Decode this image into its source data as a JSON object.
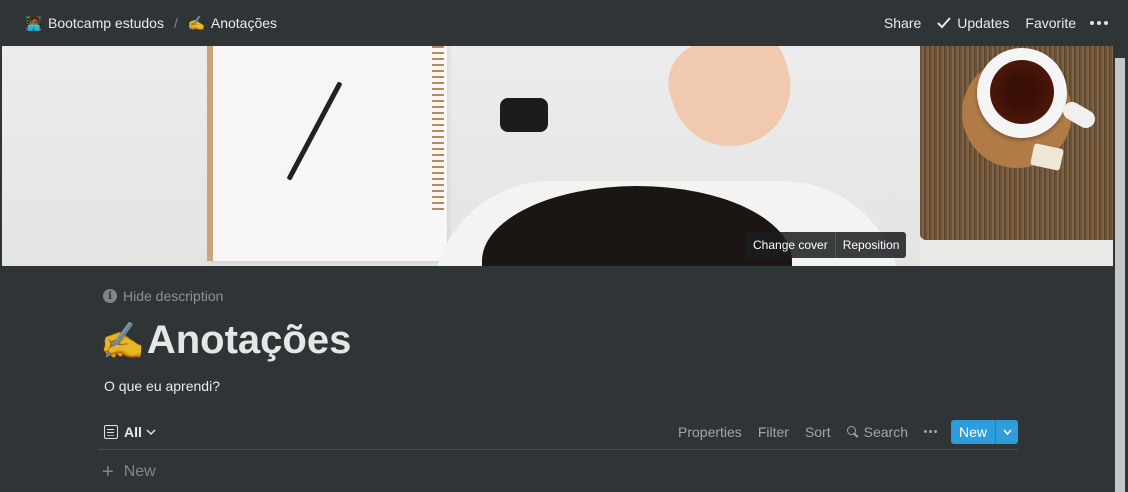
{
  "breadcrumb": {
    "items": [
      {
        "emoji": "👩🏾‍💻",
        "label": "Bootcamp estudos"
      },
      {
        "emoji": "✍️",
        "label": "Anotações"
      }
    ],
    "separator": "/"
  },
  "topbar": {
    "share_label": "Share",
    "updates_label": "Updates",
    "favorite_label": "Favorite"
  },
  "cover": {
    "change_cover_label": "Change cover",
    "reposition_label": "Reposition"
  },
  "page": {
    "hide_description_label": "Hide description",
    "title_emoji": "✍️",
    "title": "Anotações",
    "description": "O que eu aprendi?"
  },
  "view": {
    "name": "All",
    "properties_label": "Properties",
    "filter_label": "Filter",
    "sort_label": "Sort",
    "search_label": "Search",
    "new_label": "New",
    "accent_color": "#2e9ddb"
  },
  "list": {
    "new_row_label": "New"
  }
}
